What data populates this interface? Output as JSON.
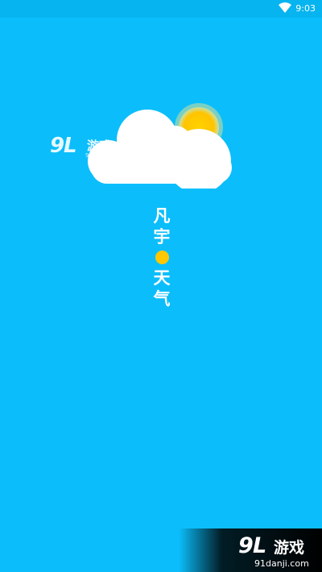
{
  "status_bar": {
    "time": "9:03",
    "icons": [
      "wifi-icon"
    ]
  },
  "splash": {
    "title_chars": [
      "凡",
      "宇",
      "天",
      "气"
    ],
    "illustration": "cloud-sun-icon",
    "dot_color": "#ffc700",
    "background_color": "#0bbefb"
  },
  "watermark_top": {
    "number": "9",
    "text": "游戏",
    "url": "91danji.com"
  },
  "watermark_bottom": {
    "number": "9",
    "text": "游戏",
    "url": "91danji.com"
  }
}
